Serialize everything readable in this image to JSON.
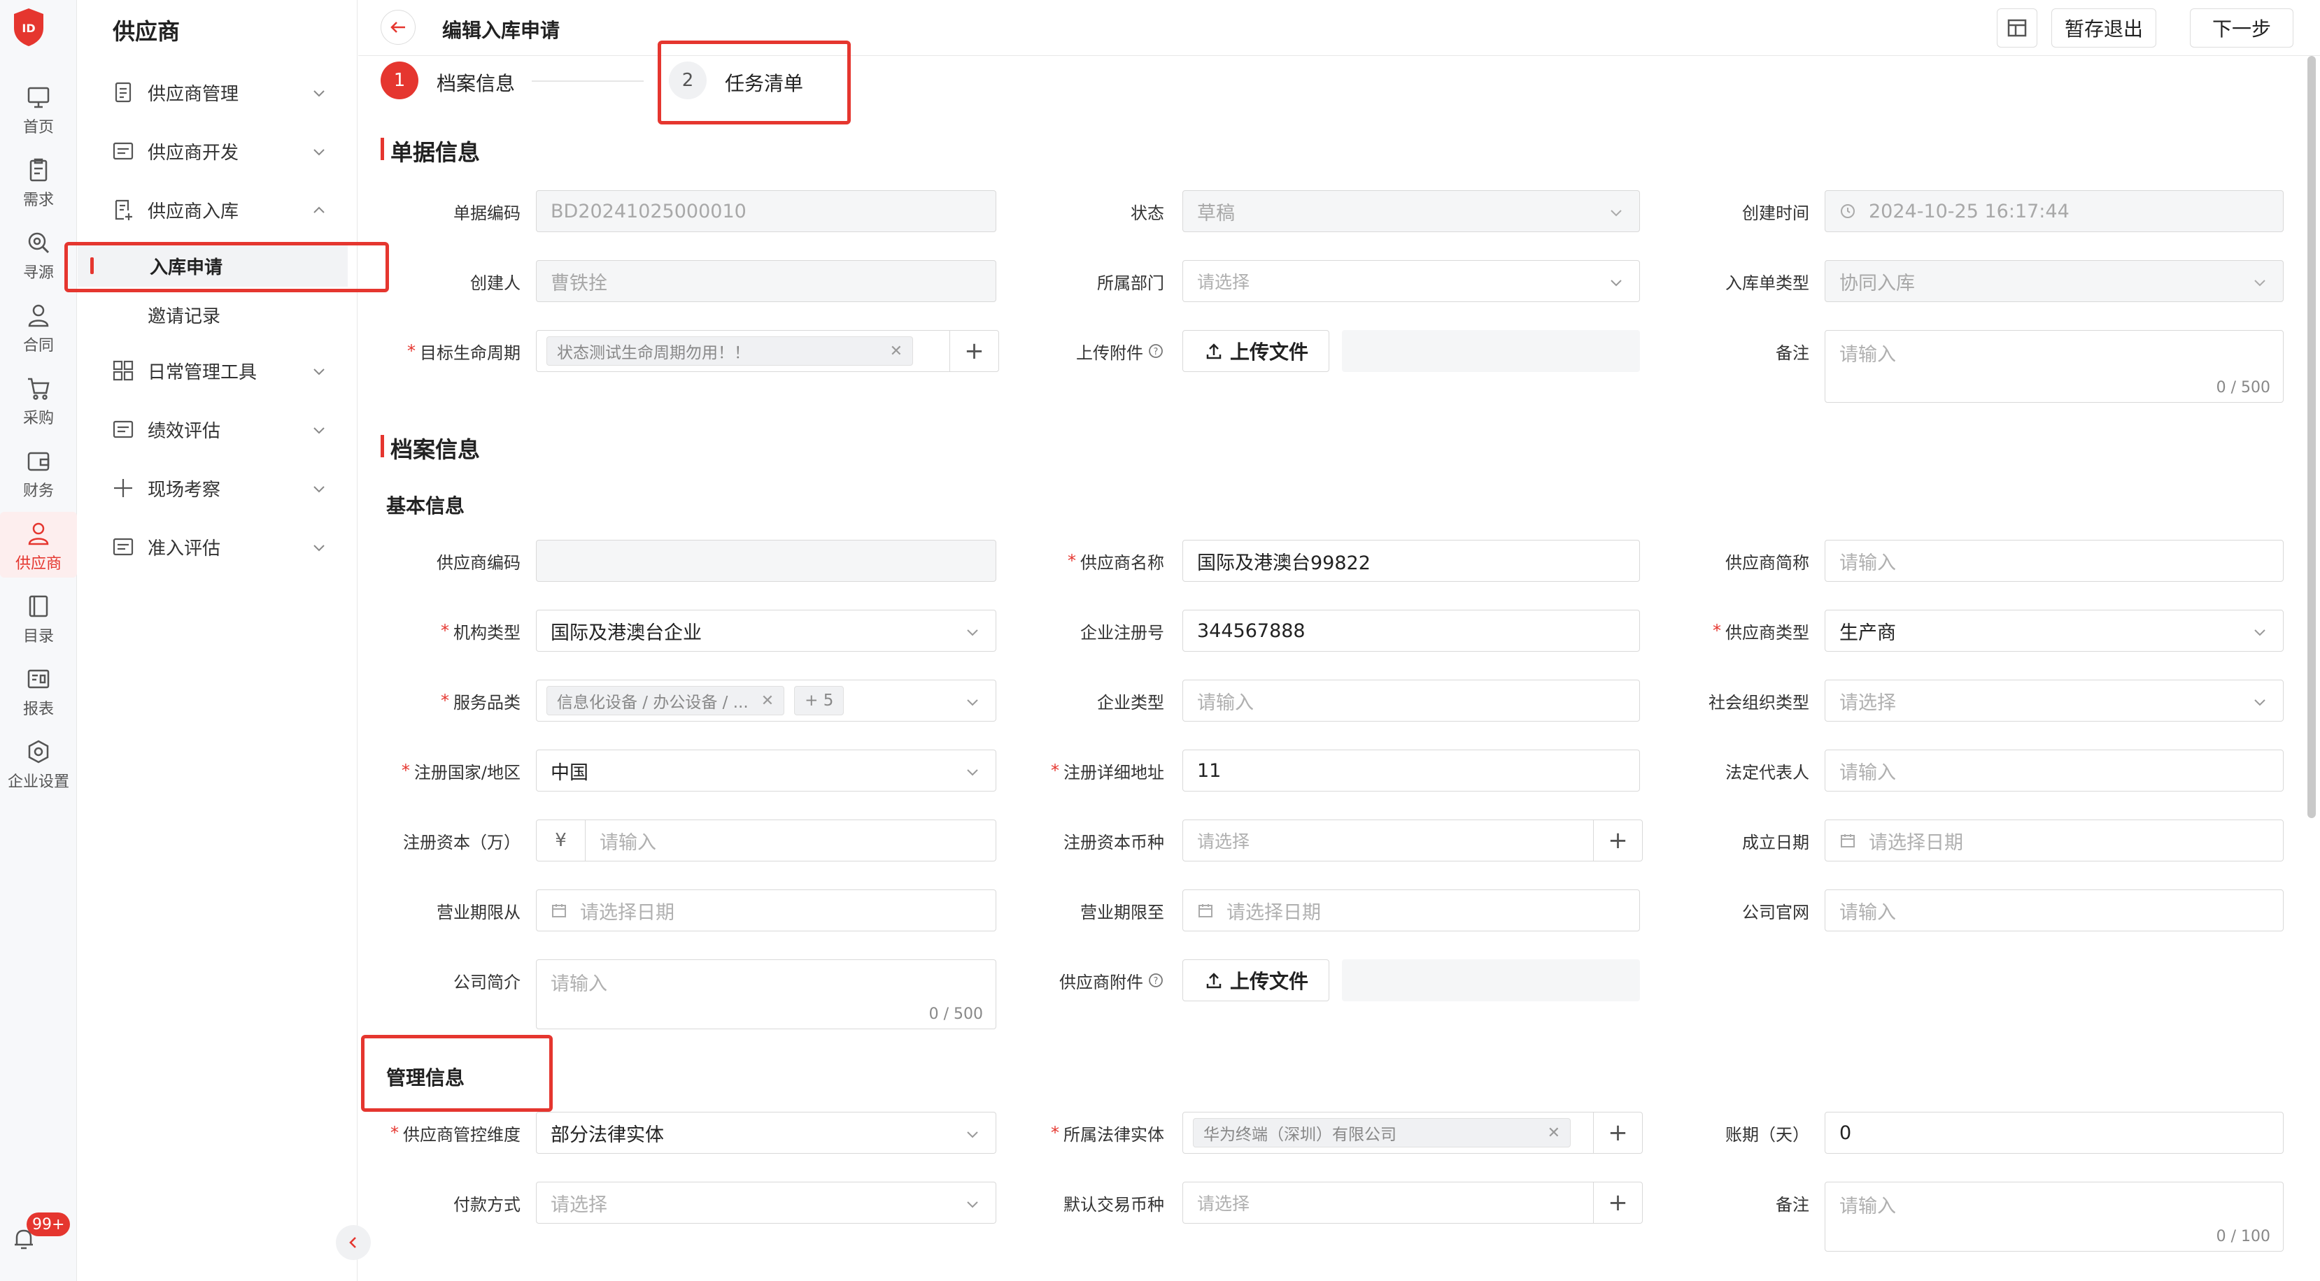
{
  "nav": {
    "items": [
      {
        "label": "首页"
      },
      {
        "label": "需求"
      },
      {
        "label": "寻源"
      },
      {
        "label": "合同"
      },
      {
        "label": "采购"
      },
      {
        "label": "财务"
      },
      {
        "label": "供应商"
      },
      {
        "label": "目录"
      },
      {
        "label": "报表"
      },
      {
        "label": "企业设置"
      }
    ],
    "badge": "99+"
  },
  "sidebar": {
    "title": "供应商",
    "menu": [
      {
        "label": "供应商管理"
      },
      {
        "label": "供应商开发"
      },
      {
        "label": "供应商入库"
      },
      {
        "label": "入库申请"
      },
      {
        "label": "邀请记录"
      },
      {
        "label": "日常管理工具"
      },
      {
        "label": "绩效评估"
      },
      {
        "label": "现场考察"
      },
      {
        "label": "准入评估"
      }
    ]
  },
  "header": {
    "title": "编辑入库申请",
    "save_exit": "暂存退出",
    "next": "下一步"
  },
  "steps": [
    {
      "num": "1",
      "label": "档案信息"
    },
    {
      "num": "2",
      "label": "任务清单"
    }
  ],
  "doc": {
    "title": "单据信息",
    "code_label": "单据编码",
    "code_value": "BD20241025000010",
    "status_label": "状态",
    "status_value": "草稿",
    "created_label": "创建时间",
    "created_value": "2024-10-25 16:17:44",
    "creator_label": "创建人",
    "creator_value": "曹铁拴",
    "dept_label": "所属部门",
    "dept_placeholder": "请选择",
    "type_label": "入库单类型",
    "type_value": "协同入库",
    "lifecycle_label": "目标生命周期",
    "lifecycle_tag": "状态测试生命周期勿用！！",
    "upload_label": "上传附件",
    "upload_btn": "上传文件",
    "remark_label": "备注",
    "remark_placeholder": "请输入",
    "remark_counter": "0 / 500"
  },
  "archive": {
    "title": "档案信息",
    "basic_title": "基本信息",
    "supplier_code_label": "供应商编码",
    "supplier_name_label": "供应商名称",
    "supplier_name_value": "国际及港澳台99822",
    "short_name_label": "供应商简称",
    "short_name_placeholder": "请输入",
    "org_type_label": "机构类型",
    "org_type_value": "国际及港澳台企业",
    "reg_no_label": "企业注册号",
    "reg_no_value": "344567888",
    "supplier_type_label": "供应商类型",
    "supplier_type_value": "生产商",
    "service_label": "服务品类",
    "service_tag": "信息化设备 / 办公设备 / ...",
    "service_more": "+ 5",
    "ent_type_label": "企业类型",
    "ent_type_placeholder": "请输入",
    "social_label": "社会组织类型",
    "social_placeholder": "请选择",
    "country_label": "注册国家/地区",
    "country_value": "中国",
    "address_label": "注册详细地址",
    "address_value": "11",
    "legal_label": "法定代表人",
    "legal_placeholder": "请输入",
    "capital_label": "注册资本（万）",
    "capital_prefix": "¥",
    "capital_placeholder": "请输入",
    "currency_label": "注册资本币种",
    "currency_placeholder": "请选择",
    "found_label": "成立日期",
    "found_placeholder": "请选择日期",
    "term_from_label": "营业期限从",
    "term_from_placeholder": "请选择日期",
    "term_to_label": "营业期限至",
    "term_to_placeholder": "请选择日期",
    "website_label": "公司官网",
    "website_placeholder": "请输入",
    "intro_label": "公司简介",
    "intro_placeholder": "请输入",
    "intro_counter": "0 / 500",
    "attach_label": "供应商附件",
    "attach_btn": "上传文件"
  },
  "manage": {
    "title": "管理信息",
    "dim_label": "供应商管控维度",
    "dim_value": "部分法律实体",
    "entity_label": "所属法律实体",
    "entity_tag": "华为终端（深圳）有限公司",
    "period_label": "账期（天）",
    "period_value": "0",
    "pay_label": "付款方式",
    "pay_placeholder": "请选择",
    "trade_currency_label": "默认交易币种",
    "trade_currency_placeholder": "请选择",
    "remark_label": "备注",
    "remark_placeholder": "请输入",
    "remark_counter": "0 / 100"
  }
}
